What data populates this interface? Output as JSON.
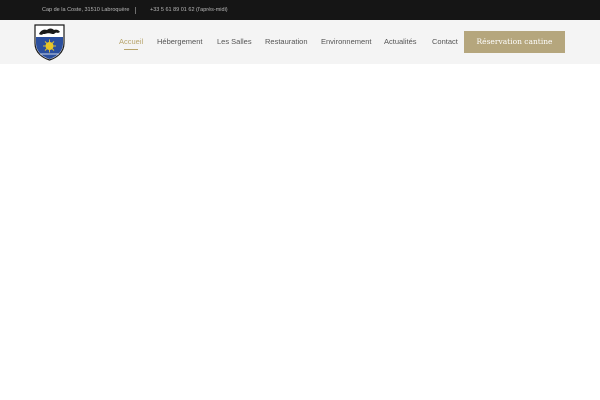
{
  "topbar": {
    "address": "Cap de la Coste, 31510 Labroquère",
    "phone": "+33 5 61 89 01 62 (l'après-midi)"
  },
  "nav": {
    "items": [
      {
        "label": "Accueil",
        "active": true
      },
      {
        "label": "Hébergement",
        "active": false
      },
      {
        "label": "Les Salles",
        "active": false
      },
      {
        "label": "Restauration",
        "active": false
      },
      {
        "label": "Environnement",
        "active": false
      },
      {
        "label": "Actualités",
        "active": false
      },
      {
        "label": "Contact",
        "active": false
      }
    ],
    "cta_label": "Réservation cantine"
  },
  "colors": {
    "topbar_bg": "#151515",
    "header_bg": "#f4f4f4",
    "accent": "#b7a46c",
    "cta_bg": "#b5a67d",
    "nav_text": "#555555"
  },
  "logo": {
    "icon": "coat-of-arms-icon"
  }
}
